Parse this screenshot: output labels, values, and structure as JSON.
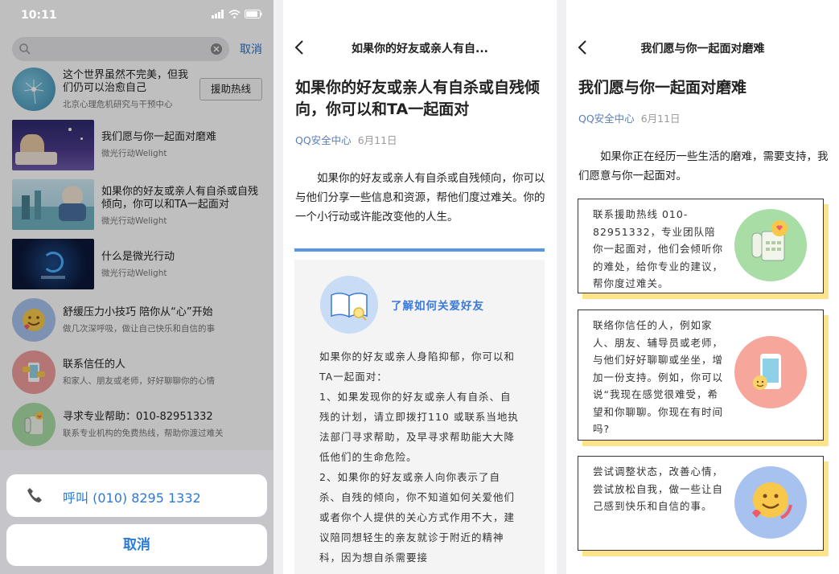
{
  "status": {
    "time": "10:11"
  },
  "search": {
    "cancel_label": "取消"
  },
  "results": [
    {
      "title": "这个世界虽然不完美，但我们仍可以治愈自己",
      "subtitle": "北京心理危机研究与干预中心",
      "button": "援助热线"
    },
    {
      "title": "我们愿与你一起面对磨难",
      "subtitle": "微光行动Welight"
    },
    {
      "title": "如果你的好友或亲人有自杀或自残倾向，你可以和TA一起面对",
      "subtitle": "微光行动Welight"
    },
    {
      "title": "什么是微光行动",
      "subtitle": "微光行动Welight"
    },
    {
      "title": "舒缓压力小技巧 陪你从“心”开始",
      "subtitle": "做几次深呼吸，做让自己快乐和自信的事"
    },
    {
      "title": "联系信任的人",
      "subtitle": "和家人、朋友或老师，好好聊聊你的心情"
    },
    {
      "title": "寻求专业帮助：010-82951332",
      "subtitle": "联系专业机构的免费热线，帮助你渡过难关"
    }
  ],
  "action_sheet": {
    "call_label": "呼叫 (010) 8295 1332",
    "cancel_label": "取消"
  },
  "article1": {
    "nav_title": "如果你的好友或亲人有自...",
    "title": "如果你的好友或亲人有自杀或自残倾向，你可以和TA一起面对",
    "source": "QQ安全中心",
    "date": "6月11日",
    "intro": "如果你的好友或亲人有自杀或自残倾向，你可以与他们分享一些信息和资源，帮他们度过难关。你的一个小行动或许能改变他的人生。",
    "box_link": "了解如何关爱好友",
    "box_text": "如果你的好友或亲人身陷抑郁，你可以和TA一起面对：\n1、如果发现你的好友或亲人有自杀、自残的计划，请立即拨打110 或联系当地执法部门寻求帮助，及早寻求帮助能大大降低他们的生命危险。\n2、如果你的好友或亲人向你表示了自杀、自残的倾向，你不知道如何关爱他们或者你个人提供的关心方式作用不大，建议陪同想轻生的亲友就诊于附近的精神科，因为想自杀需要接"
  },
  "article2": {
    "nav_title": "我们愿与你一起面对磨难",
    "title": "我们愿与你一起面对磨难",
    "source": "QQ安全中心",
    "date": "6月11日",
    "intro": "如果你正在经历一些生活的磨难，需要支持，我们愿意与你一起面对。",
    "cards": [
      {
        "text": "联系援助热线 010-82951332，专业团队陪你一起面对，他们会倾听你的难处，给你专业的建议，帮你度过难关。"
      },
      {
        "text": "联络你信任的人，例如家人、朋友、辅导员或老师，与他们好好聊聊或坐坐，增加一份支持。例如，你可以说“我现在感觉很难受，希望和你聊聊。你现在有时间吗?"
      },
      {
        "text": "尝试调整状态，改善心情，尝试放松自我，做一些让自己感到快乐和自信的事。"
      }
    ]
  },
  "colors": {
    "accent_blue": "#2a7ad8",
    "source_blue": "#5b7fb9",
    "card_shadow": "#fde48a",
    "bar_blue": "#5b95e6"
  }
}
